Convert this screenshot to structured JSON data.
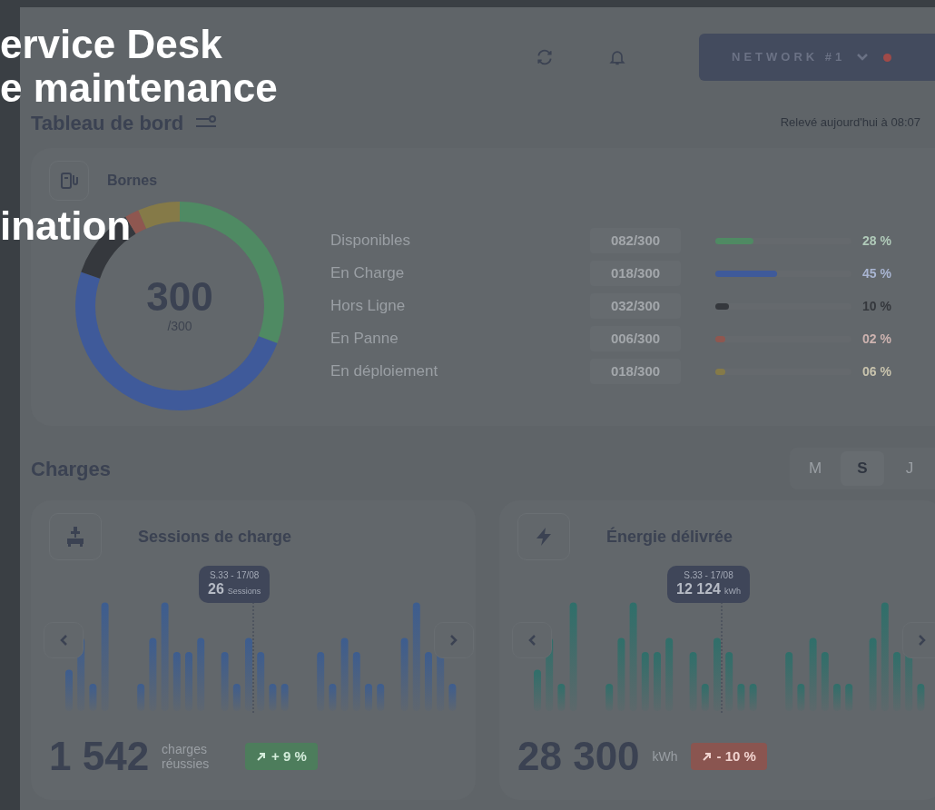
{
  "menu_overlay": {
    "items": [
      "ervice Desk",
      "e maintenance",
      "ination"
    ]
  },
  "header": {
    "network": {
      "label": "NETWORK #1",
      "alert": true
    }
  },
  "dashboard": {
    "title": "Tableau de bord",
    "reading": "Relevé aujourd'hui à 08:07"
  },
  "bornes": {
    "title": "Bornes",
    "total": "300",
    "total_sub": "/300",
    "rows": [
      {
        "label": "Disponibles",
        "count": "082/300",
        "level": 0.28,
        "percent": "28 %",
        "color": "#4f8a63"
      },
      {
        "label": "En Charge",
        "count": "018/300",
        "level": 0.45,
        "percent": "45 %",
        "color": "#3f5a9a"
      },
      {
        "label": "Hors Ligne",
        "count": "032/300",
        "level": 0.1,
        "percent": "10 %",
        "color": "#35383d"
      },
      {
        "label": "En Panne",
        "count": "006/300",
        "level": 0.02,
        "percent": "02 %",
        "color": "#8f5750"
      },
      {
        "label": "En déploiement",
        "count": "018/300",
        "level": 0.06,
        "percent": "06 %",
        "color": "#857a48"
      }
    ]
  },
  "charges": {
    "title": "Charges",
    "periods": [
      {
        "label": "M",
        "selected": false
      },
      {
        "label": "S",
        "selected": true
      },
      {
        "label": "J",
        "selected": false
      }
    ],
    "cards": [
      {
        "kind": "sessions",
        "title": "Sessions de charge",
        "color": "#3d5d8f",
        "tooltip": {
          "period": "S.33 - 17/08",
          "value": "26",
          "unit": "Sessions"
        },
        "total": "1 542",
        "unit": "charges réussies",
        "trend": {
          "text": "+ 9 %",
          "positive": true
        }
      },
      {
        "kind": "energy",
        "title": "Énergie délivrée",
        "color": "#2f6f6a",
        "tooltip": {
          "period": "S.33 - 17/08",
          "value": "12 124",
          "unit": "kWh"
        },
        "total": "28 300",
        "unit": "kWh",
        "trend": {
          "text": "- 10 %",
          "positive": false
        }
      }
    ]
  }
}
